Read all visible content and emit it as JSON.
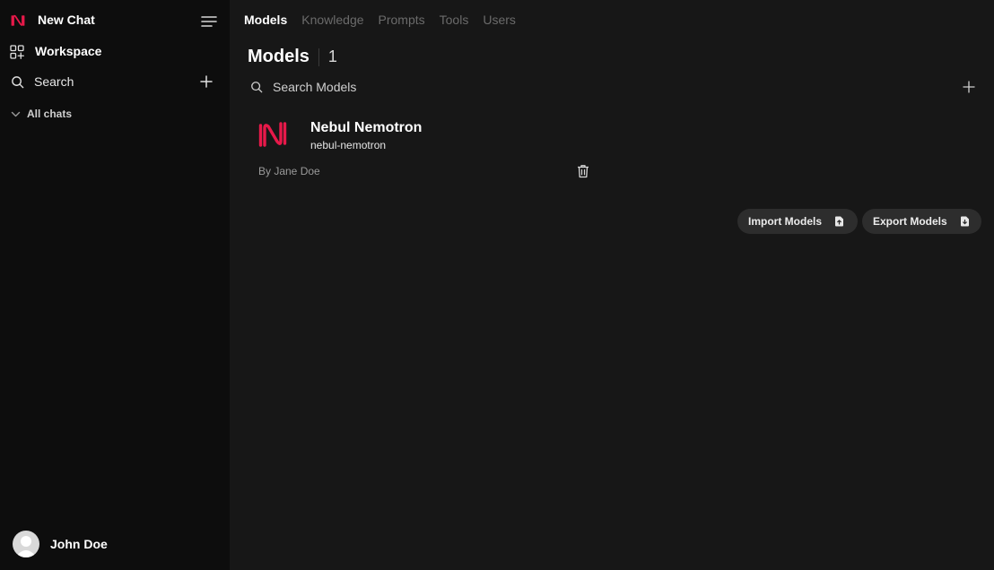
{
  "sidebar": {
    "new_chat_label": "New Chat",
    "workspace_label": "Workspace",
    "search_label": "Search",
    "all_chats_label": "All chats",
    "user_name": "John Doe"
  },
  "tabs": [
    {
      "label": "Models",
      "active": true
    },
    {
      "label": "Knowledge",
      "active": false
    },
    {
      "label": "Prompts",
      "active": false
    },
    {
      "label": "Tools",
      "active": false
    },
    {
      "label": "Users",
      "active": false
    }
  ],
  "main": {
    "title": "Models",
    "count": "1",
    "search_placeholder": "Search Models",
    "models": [
      {
        "name": "Nebul Nemotron",
        "id": "nebul-nemotron",
        "author": "By Jane Doe"
      }
    ],
    "import_label": "Import Models",
    "export_label": "Export Models"
  },
  "colors": {
    "brand": "#e8194a",
    "sidebar_bg": "#0d0d0d",
    "main_bg": "#171717",
    "button_bg": "#2d2d2d"
  },
  "icons": [
    "nebul-logo-icon",
    "menu-icon",
    "workspace-icon",
    "search-icon",
    "plus-icon",
    "chevron-down-icon",
    "avatar-icon",
    "trash-icon",
    "import-icon",
    "export-icon"
  ]
}
